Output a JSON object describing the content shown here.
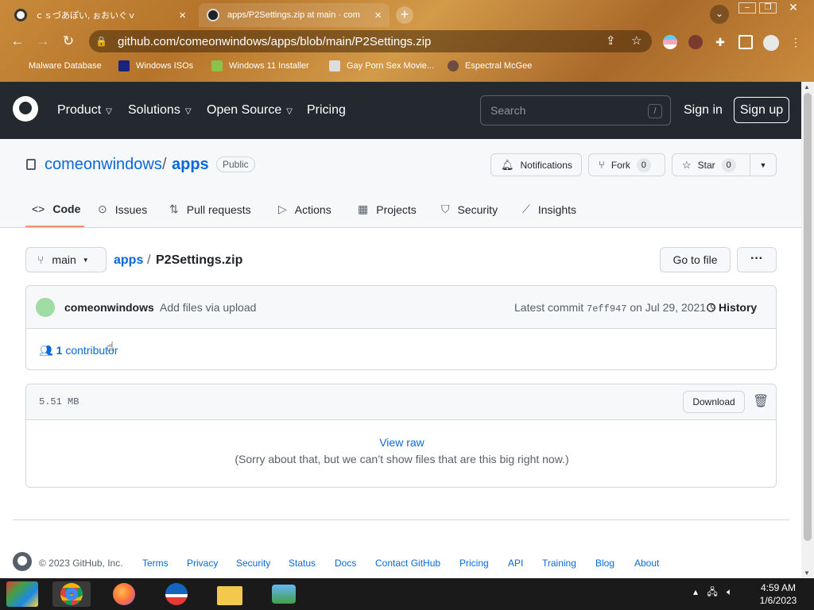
{
  "browser": {
    "tabs": [
      {
        "title": "ｃｓづあぽい, ぉおいぐｖ",
        "close": "×"
      },
      {
        "title": "apps/P2Settings.zip at main · com",
        "close": "×"
      }
    ],
    "new_tab": "+",
    "tab_dropdown": "⌄",
    "url": "github.com/comeonwindows/apps/blob/main/P2Settings.zip",
    "bookmarks": [
      "Malware Database",
      "Windows ISOs",
      "Windows 11 Installer",
      "Gay Porn Sex Movie...",
      "Espectral McGee"
    ]
  },
  "github": {
    "nav": [
      "Product",
      "Solutions",
      "Open Source",
      "Pricing"
    ],
    "search_placeholder": "Search",
    "search_shortcut": "/",
    "sign_in": "Sign in",
    "sign_up": "Sign up"
  },
  "repo": {
    "owner": "comeonwindows",
    "separator": "/",
    "name": "apps",
    "visibility": "Public",
    "notifications": "Notifications",
    "fork": "Fork",
    "fork_count": "0",
    "star": "Star",
    "star_count": "0",
    "tabs": [
      "Code",
      "Issues",
      "Pull requests",
      "Actions",
      "Projects",
      "Security",
      "Insights"
    ]
  },
  "file": {
    "branch": "main",
    "breadcrumb_repo": "apps",
    "breadcrumb_sep": "/",
    "filename": "P2Settings.zip",
    "go_to_file": "Go to file",
    "more": "···",
    "commit_user": "comeonwindows",
    "commit_message": "Add files via upload",
    "latest_commit_label": "Latest commit",
    "commit_sha": "7eff947",
    "commit_date": "on Jul 29, 2021",
    "history": "History",
    "contributors_count": "1",
    "contributors_label": "contributor",
    "size": "5.51 MB",
    "download": "Download",
    "view_raw": "View raw",
    "too_big": "(Sorry about that, but we can’t show files that are this big right now.)"
  },
  "footer": {
    "copyright": "© 2023 GitHub, Inc.",
    "links": [
      "Terms",
      "Privacy",
      "Security",
      "Status",
      "Docs",
      "Contact GitHub",
      "Pricing",
      "API",
      "Training",
      "Blog",
      "About"
    ]
  },
  "taskbar": {
    "time": "4:59 AM",
    "date": "1/6/2023"
  },
  "colors": {
    "accent": "#0969da",
    "header_bg": "#24292f",
    "tab_underline": "#fd8c73"
  }
}
